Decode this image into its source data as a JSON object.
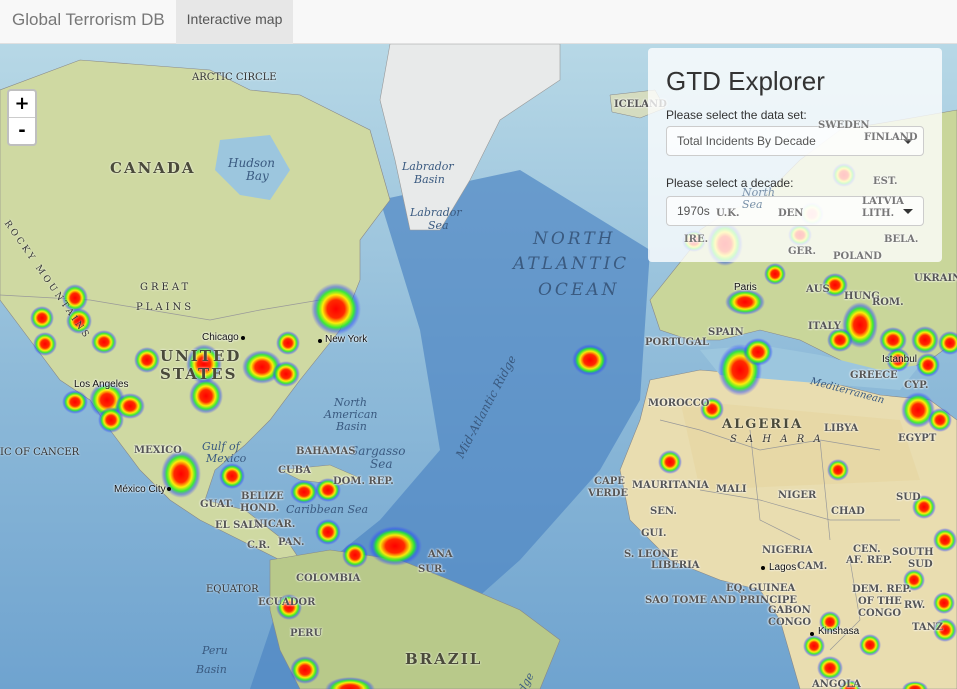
{
  "navbar": {
    "brand": "Global Terrorism DB",
    "tab": "Interactive map"
  },
  "zoom": {
    "in": "+",
    "out": "-"
  },
  "panel": {
    "title": "GTD Explorer",
    "dataset_label": "Please select the data set:",
    "dataset_value": "Total Incidents By Decade",
    "decade_label": "Please select a decade:",
    "decade_value": "1970s"
  },
  "map_labels": {
    "arctic": "ARCTIC CIRCLE",
    "canada": "CANADA",
    "hudson": "Hudson",
    "bay": "Bay",
    "labrador_basin1": "Labrador",
    "labrador_basin2": "Basin",
    "labrador_sea1": "Labrador",
    "labrador_sea2": "Sea",
    "north": "NORTH",
    "atlantic": "ATLANTIC",
    "ocean": "OCEAN",
    "iceland": "ICELAND",
    "sweden": "SWEDEN",
    "finland": "FINLAND",
    "north_sea": "North",
    "north_sea2": "Sea",
    "rocky": "ROCKY MOUNTAINS",
    "great": "GREAT",
    "plains": "PLAINS",
    "united": "UNITED",
    "states": "STATES",
    "chicago": "Chicago",
    "newyork": "New York",
    "losangeles": "Los Angeles",
    "portugal": "PORTUGAL",
    "spain": "SPAIN",
    "paris": "Paris",
    "morocco": "MOROCCO",
    "algeria": "ALGERIA",
    "libya": "LIBYA",
    "egypt": "EGYPT",
    "sahara": "S A H A R A",
    "mediterranean": "Mediterranean",
    "na_basin1": "North",
    "na_basin2": "American",
    "na_basin3": "Basin",
    "sargasso1": "Sargasso",
    "sargasso2": "Sea",
    "midatlantic": "Mid-Atlantic Ridge",
    "bahamas": "BAHAMAS",
    "gulf1": "Gulf of",
    "gulf2": "Mexico",
    "mexico": "MEXICO",
    "mexicocity": "México City",
    "cancer": "IC OF CANCER",
    "cuba": "CUBA",
    "domrep": "DOM. REP.",
    "belize": "BELIZE",
    "hond": "HOND.",
    "guat": "GUAT.",
    "elsalv": "EL SALV.",
    "nicar": "NICAR.",
    "cr": "C.R.",
    "pan": "PAN.",
    "caribbean": "Caribbean Sea",
    "colombia": "COLOMBIA",
    "guyana": "ANA",
    "sur": "SUR.",
    "equator": "EQUATOR",
    "ecuador": "ECUADOR",
    "peru": "PERU",
    "perubasin1": "Peru",
    "perubasin2": "Basin",
    "brazil": "BRAZIL",
    "capeverde1": "CAPE",
    "capeverde2": "VERDE",
    "mauritania": "MAURITANIA",
    "mali": "MALI",
    "niger": "NIGER",
    "chad": "CHAD",
    "sen": "SEN.",
    "gui": "GUI.",
    "sleone": "S. LEONE",
    "liberia": "LIBERIA",
    "nigeria": "NIGERIA",
    "lagos": "Lagos",
    "cam": "CAM.",
    "eqguinea": "EQ. GUINEA",
    "saotome": "SAO TOME AND PRINCIPE",
    "gabon": "GABON",
    "congo": "CONGO",
    "cen1": "CEN.",
    "cen2": "AF. REP.",
    "southsudan1": "SOUTH",
    "southsudan2": "SUD",
    "demrep1": "DEM. REP.",
    "demrep2": "OF THE",
    "demrep3": "CONGO",
    "kinshasa": "Kinshasa",
    "angola": "ANGOLA",
    "rw": "RW.",
    "tanz": "TANZ",
    "ukraine": "UKRAIN",
    "poland": "POLAND",
    "bela": "BELA.",
    "lith": "LITH.",
    "latvia": "LATVIA",
    "est": "EST.",
    "rom": "ROM.",
    "greece": "GREECE",
    "cyp": "CYP.",
    "istanbul": "Istanbul",
    "hung": "HUNG",
    "aus": "AUS",
    "italy": "ITALY",
    "uk": "U.K.",
    "den": "DEN",
    "ger": "GER.",
    "ire": "IRE.",
    "sud": "SUD",
    "mid_ridge2": "Ridge"
  }
}
